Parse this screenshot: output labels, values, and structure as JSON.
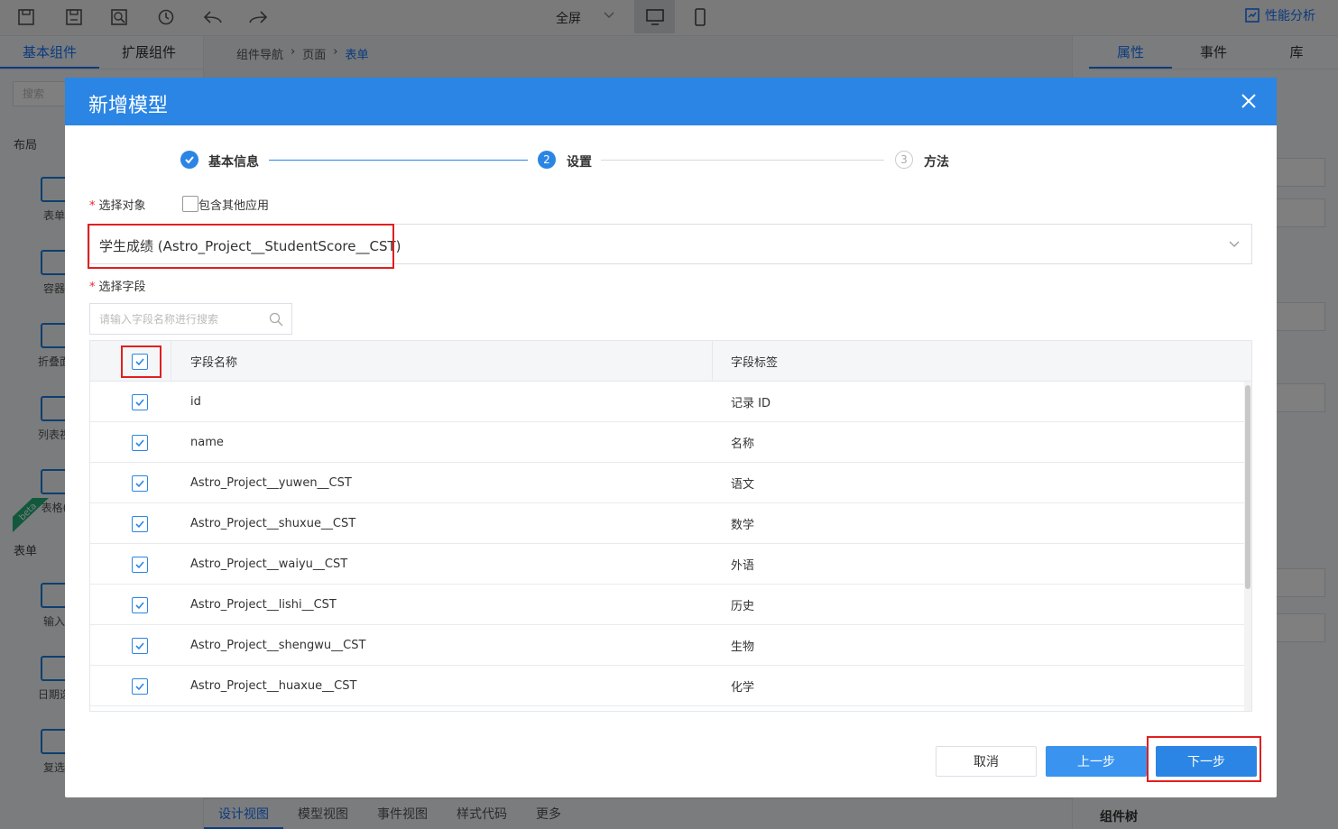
{
  "topbar": {
    "fullscreen_label": "全屏",
    "perf_label": "性能分析"
  },
  "left_panel": {
    "tabs": [
      "基本组件",
      "扩展组件"
    ],
    "search_placeholder": "搜索",
    "section_layout": "布局",
    "section_form": "表单",
    "items": [
      "表单",
      "容器",
      "折叠面",
      "列表视",
      "表格(",
      "输入",
      "日期选",
      "复选"
    ],
    "beta_label": "beta"
  },
  "center": {
    "breadcrumb": [
      "组件导航",
      "页面",
      "表单"
    ],
    "bottom_tabs": [
      "设计视图",
      "模型视图",
      "事件视图",
      "样式代码",
      "更多"
    ]
  },
  "right_panel": {
    "tabs": [
      "属性",
      "事件",
      "库"
    ],
    "bottom_label": "组件树"
  },
  "modal": {
    "title": "新增模型",
    "steps": [
      {
        "number": "",
        "label": "基本信息",
        "status": "done"
      },
      {
        "number": "2",
        "label": "设置",
        "status": "active"
      },
      {
        "number": "3",
        "label": "方法",
        "status": "pending"
      }
    ],
    "select_object_label": "选择对象",
    "include_other_apps_label": "包含其他应用",
    "include_other_apps_checked": false,
    "selected_object": "学生成绩 (Astro_Project__StudentScore__CST)",
    "select_fields_label": "选择字段",
    "field_search_placeholder": "请输入字段名称进行搜索",
    "table": {
      "headers": [
        "字段名称",
        "字段标签"
      ],
      "all_checked": true,
      "rows": [
        {
          "name": "id",
          "label": "记录 ID",
          "checked": true
        },
        {
          "name": "name",
          "label": "名称",
          "checked": true
        },
        {
          "name": "Astro_Project__yuwen__CST",
          "label": "语文",
          "checked": true
        },
        {
          "name": "Astro_Project__shuxue__CST",
          "label": "数学",
          "checked": true
        },
        {
          "name": "Astro_Project__waiyu__CST",
          "label": "外语",
          "checked": true
        },
        {
          "name": "Astro_Project__lishi__CST",
          "label": "历史",
          "checked": true
        },
        {
          "name": "Astro_Project__shengwu__CST",
          "label": "生物",
          "checked": true
        },
        {
          "name": "Astro_Project__huaxue__CST",
          "label": "化学",
          "checked": true
        }
      ]
    },
    "buttons": {
      "cancel": "取消",
      "prev": "上一步",
      "next": "下一步"
    }
  },
  "colors": {
    "primary": "#2b85e4",
    "highlight": "#e02020",
    "required": "#e23"
  }
}
